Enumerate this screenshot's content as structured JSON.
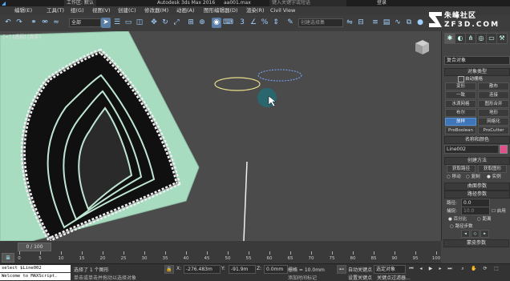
{
  "window": {
    "workspace": "工作区: 默认",
    "app_title": "Autodesk 3ds Max 2016",
    "file_name": "aa001.max",
    "search_placeholder": "键入关键字或短语",
    "login": "登录"
  },
  "menu": [
    "编辑(E)",
    "工具(T)",
    "组(G)",
    "视图(V)",
    "创建(C)",
    "修改器(M)",
    "动画(A)",
    "图形编辑器(D)",
    "渲染(R)",
    "Civil View"
  ],
  "toolbar": {
    "filter": "全部",
    "selection_set_placeholder": "创建选择集"
  },
  "viewport": {
    "label": "[+] [透视] [真实]"
  },
  "command_panel": {
    "category_dropdown": "复合对象",
    "object_type_header": "对象类型",
    "autogrid_label": "自动栅格",
    "buttons": [
      {
        "label": "变形",
        "active": false
      },
      {
        "label": "散布",
        "active": false
      },
      {
        "label": "一致",
        "active": false
      },
      {
        "label": "连接",
        "active": false
      },
      {
        "label": "水滴网格",
        "active": false
      },
      {
        "label": "图形合并",
        "active": false
      },
      {
        "label": "布尔",
        "active": false
      },
      {
        "label": "地形",
        "active": false
      },
      {
        "label": "放样",
        "active": true
      },
      {
        "label": "网格化",
        "active": false
      },
      {
        "label": "ProBoolean",
        "active": false
      },
      {
        "label": "ProCutter",
        "active": false
      }
    ],
    "name_color_header": "名称和颜色",
    "object_name": "Line002",
    "object_color": "#e0508a",
    "creation_method_header": "创建方法",
    "get_path_label": "获取路径",
    "get_shape_label": "获取图形",
    "move_label": "移动",
    "copy_label": "复制",
    "instance_label": "实例",
    "surface_params_header": "曲面参数",
    "path_params_header": "路径参数",
    "path_label": "路径:",
    "path_value": "0.0",
    "snap_label": "捕捉:",
    "snap_value": "10.0",
    "enable_label": "启用",
    "percent_label": "百分比",
    "distance_label": "距离",
    "path_steps_label": "路径步数",
    "skin_params_header": "蒙皮参数"
  },
  "timeline": {
    "frame_slider": "0 / 100",
    "ticks": [
      "0",
      "5",
      "10",
      "15",
      "20",
      "25",
      "30",
      "35",
      "40",
      "45",
      "50",
      "55",
      "60",
      "65",
      "70",
      "75",
      "80",
      "85",
      "90",
      "95",
      "100"
    ]
  },
  "status": {
    "script_line1": "select $Line002",
    "script_line2": "Welcome to MAXScript.",
    "selection_text": "选择了 1 个图形",
    "prompt_text": "单击或单击并拖动以选择对象",
    "x_label": "X:",
    "x_value": "-276.483m",
    "y_label": "Y:",
    "y_value": "-91.9m",
    "z_label": "Z:",
    "z_value": "0.0mm",
    "grid_label": "栅格 = 10.0mm",
    "add_time_tag": "添加时间标记",
    "auto_key": "自动关键点",
    "set_key": "设置关键点",
    "selected_object": "选定对象",
    "key_filters": "关键点过滤器..."
  },
  "watermark": {
    "line1": "朱峰社区",
    "line2": "ZF3D.COM"
  },
  "colors": {
    "active_blue": "#3e74b8",
    "model_green": "#a8dcc0",
    "viewport_bg": "#4b4b4b"
  }
}
